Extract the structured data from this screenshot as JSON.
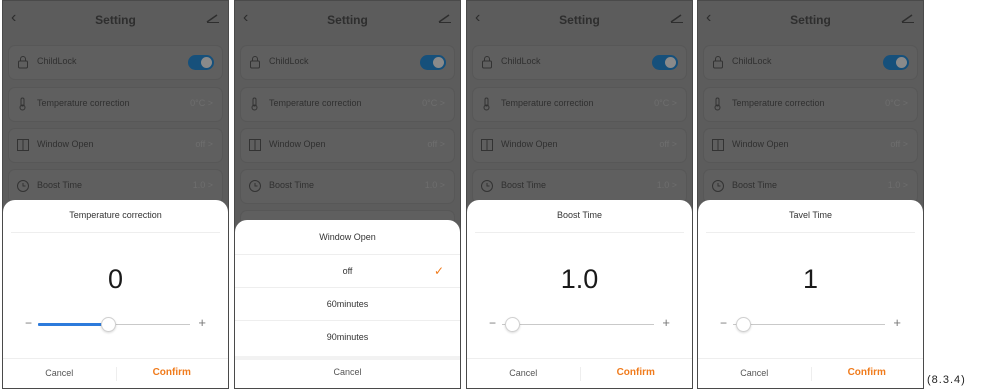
{
  "screens": [
    {
      "title": "Setting",
      "rows": [
        {
          "label": "ChildLock",
          "value": ""
        },
        {
          "label": "Temperature correction",
          "value": "0°C >"
        },
        {
          "label": "Window Open",
          "value": "off >"
        },
        {
          "label": "Boost Time",
          "value": "1.0 >"
        }
      ],
      "sheet": {
        "title": "Temperature correction",
        "value": "0",
        "minus": "−",
        "plus": "+",
        "cancel": "Cancel",
        "confirm": "Confirm"
      }
    },
    {
      "title": "Setting",
      "rows": [
        {
          "label": "ChildLock",
          "value": ""
        },
        {
          "label": "Temperature correction",
          "value": "0°C >"
        },
        {
          "label": "Window Open",
          "value": "off >"
        },
        {
          "label": "Boost Time",
          "value": "1.0 >"
        }
      ],
      "sheet": {
        "title": "Window Open",
        "options": [
          "off",
          "60minutes",
          "90minutes"
        ],
        "selected_mark": "✓",
        "cancel": "Cancel"
      }
    },
    {
      "title": "Setting",
      "rows": [
        {
          "label": "ChildLock",
          "value": ""
        },
        {
          "label": "Temperature correction",
          "value": "0°C >"
        },
        {
          "label": "Window Open",
          "value": "off >"
        },
        {
          "label": "Boost Time",
          "value": "1.0 >"
        }
      ],
      "sheet": {
        "title": "Boost Time",
        "value": "1.0",
        "minus": "−",
        "plus": "+",
        "cancel": "Cancel",
        "confirm": "Confirm"
      }
    },
    {
      "title": "Setting",
      "rows": [
        {
          "label": "ChildLock",
          "value": ""
        },
        {
          "label": "Temperature correction",
          "value": "0°C >"
        },
        {
          "label": "Window Open",
          "value": "off >"
        },
        {
          "label": "Boost Time",
          "value": "1.0 >"
        }
      ],
      "sheet": {
        "title": "Tavel Time",
        "value": "1",
        "minus": "−",
        "plus": "+",
        "cancel": "Cancel",
        "confirm": "Confirm"
      }
    }
  ],
  "caption": "(8.3.4)",
  "colors": {
    "accent": "#f07b1c",
    "slider_fill": "#2d7bdc",
    "toggle_on": "#16507b"
  }
}
